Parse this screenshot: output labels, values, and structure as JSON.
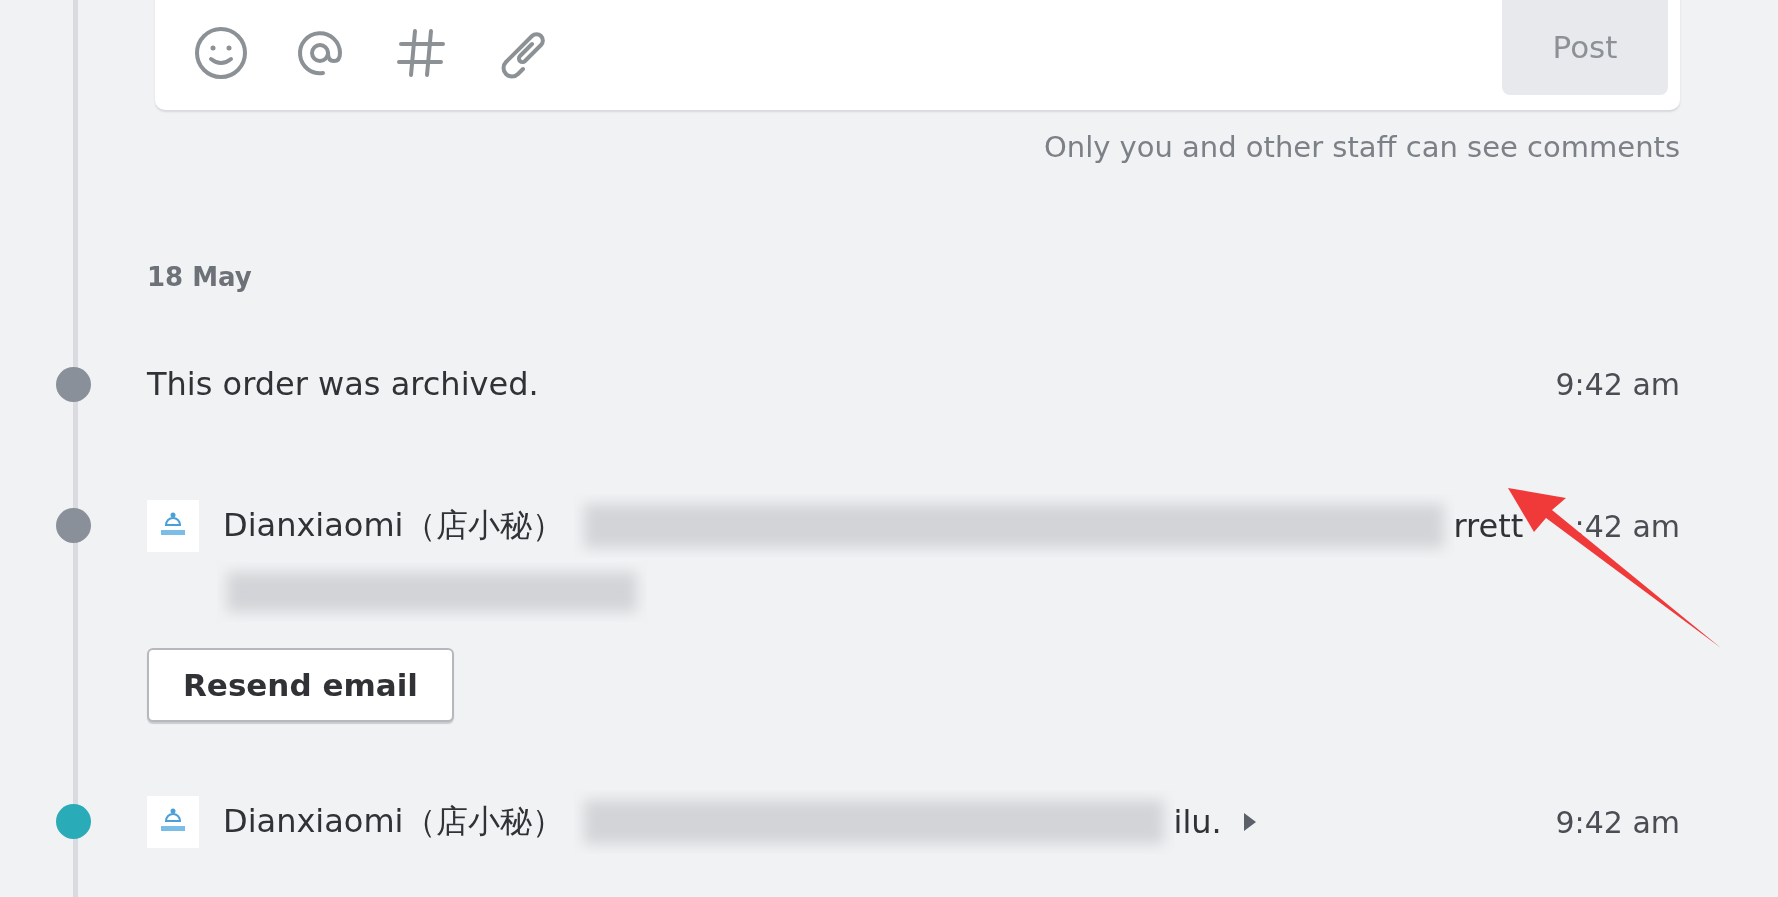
{
  "comment_box": {
    "post_button": "Post",
    "note": "Only you and other staff can see comments"
  },
  "date": "18 May",
  "events": [
    {
      "kind": "text",
      "color": "#8a909a",
      "message": "This order was archived.",
      "time": "9:42 am"
    },
    {
      "kind": "app",
      "color": "#8a909a",
      "author": "Dianxiaomi（店小秘）",
      "message_tail": "rrett",
      "second_line_redacted": true,
      "expandable": false,
      "time": ":42 am",
      "button": "Resend email"
    },
    {
      "kind": "app",
      "color": "#2aabb8",
      "author": "Dianxiaomi（店小秘）",
      "message_tail": "ilu.",
      "second_line_redacted": false,
      "expandable": true,
      "time": "9:42 am"
    }
  ]
}
